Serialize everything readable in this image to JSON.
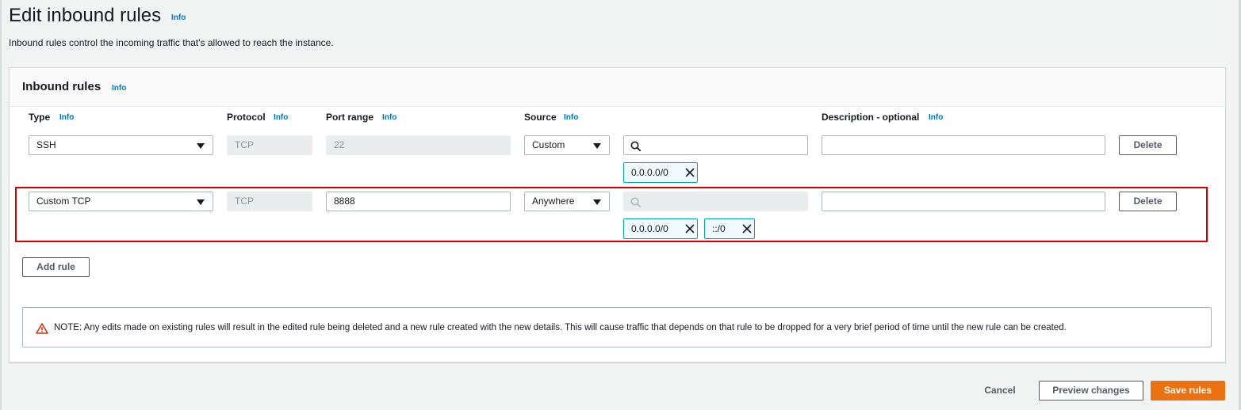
{
  "page": {
    "title": "Edit inbound rules",
    "title_info": "Info",
    "description": "Inbound rules control the incoming traffic that's allowed to reach the instance."
  },
  "panel": {
    "title": "Inbound rules",
    "title_info": "Info"
  },
  "columns": {
    "type": "Type",
    "protocol": "Protocol",
    "port_range": "Port range",
    "source": "Source",
    "description": "Description - optional",
    "info": "Info"
  },
  "rules": [
    {
      "type": "SSH",
      "protocol": "TCP",
      "port_range": "22",
      "source_mode": "Custom",
      "cidr_search": "",
      "tokens": [
        "0.0.0.0/0"
      ],
      "description": "",
      "delete_label": "Delete"
    },
    {
      "type": "Custom TCP",
      "protocol": "TCP",
      "port_range": "8888",
      "source_mode": "Anywhere",
      "cidr_search": "",
      "tokens": [
        "0.0.0.0/0",
        "::/0"
      ],
      "description": "",
      "delete_label": "Delete"
    }
  ],
  "add_rule_label": "Add rule",
  "note": "NOTE: Any edits made on existing rules will result in the edited rule being deleted and a new rule created with the new details. This will cause traffic that depends on that rule to be dropped for a very brief period of time until the new rule can be created.",
  "footer": {
    "cancel_label": "Cancel",
    "preview_label": "Preview changes",
    "save_label": "Save rules"
  },
  "colors": {
    "accent": "#ec7211",
    "link": "#0073bb",
    "highlight": "#d40000",
    "warning": "#d13212",
    "token_border": "#00a1c9"
  },
  "icons": {
    "search": "search-icon",
    "dropdown": "caret-down-icon",
    "remove_token": "close-icon",
    "warning": "warning-icon"
  }
}
